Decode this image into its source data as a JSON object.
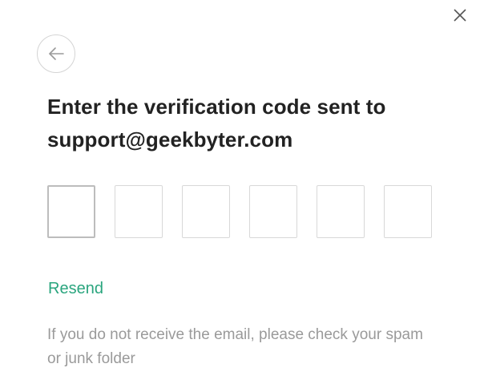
{
  "icons": {
    "close": "close-icon",
    "back": "arrow-left-icon"
  },
  "title": {
    "line1": "Enter the verification code sent to",
    "line2": "support@geekbyter.com"
  },
  "code_inputs": [
    "",
    "",
    "",
    "",
    "",
    ""
  ],
  "resend_label": "Resend",
  "hint": "If you do not receive the email, please check your spam or junk folder",
  "colors": {
    "accent": "#2aa57e",
    "title": "#222222",
    "hint": "#9a9a9a",
    "border": "#d8d8d8"
  }
}
